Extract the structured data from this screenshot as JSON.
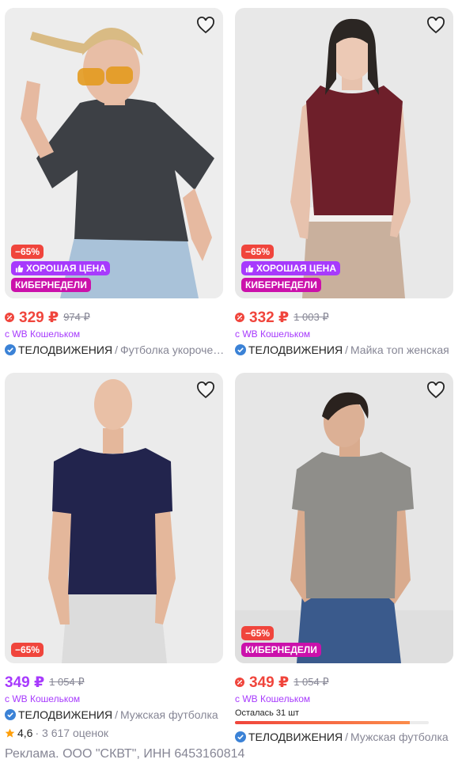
{
  "cards": [
    {
      "discount": "−65%",
      "good_price": "ХОРОШАЯ ЦЕНА",
      "promo": "КИБЕРНЕДЕЛИ",
      "price": "329 ₽",
      "old_price": "974 ₽",
      "wallet": "с WB Кошельком",
      "brand": "ТЕЛОДВИЖЕНИЯ",
      "separator": "/",
      "name": "Футболка укороченная",
      "price_color": "#f0453c"
    },
    {
      "discount": "−65%",
      "good_price": "ХОРОШАЯ ЦЕНА",
      "promo": "КИБЕРНЕДЕЛИ",
      "price": "332 ₽",
      "old_price": "1 003 ₽",
      "wallet": "с WB Кошельком",
      "brand": "ТЕЛОДВИЖЕНИЯ",
      "separator": "/",
      "name": "Майка топ женская",
      "price_color": "#f0453c"
    },
    {
      "discount": "−65%",
      "price": "349 ₽",
      "old_price": "1 054 ₽",
      "wallet": "с WB Кошельком",
      "brand": "ТЕЛОДВИЖЕНИЯ",
      "separator": "/",
      "name": "Мужская футболка",
      "rating": "4,6",
      "reviews": "· 3 617 оценок",
      "price_color": "#a73afd"
    },
    {
      "discount": "−65%",
      "promo": "КИБЕРНЕДЕЛИ",
      "price": "349 ₽",
      "old_price": "1 054 ₽",
      "wallet": "с WB Кошельком",
      "stock": "Осталась 31 шт",
      "stock_fraction": 0.9,
      "brand": "ТЕЛОДВИЖЕНИЯ",
      "separator": "/",
      "name": "Мужская футболка",
      "price_color": "#f0453c"
    }
  ],
  "ad_text": "Реклама. ООО \"СКВТ\", ИНН 6453160814",
  "colors": {
    "accent_purple": "#a73afd",
    "discount_red": "#f0453c",
    "promo_magenta": "#cb11ab",
    "muted_text": "#868695"
  }
}
